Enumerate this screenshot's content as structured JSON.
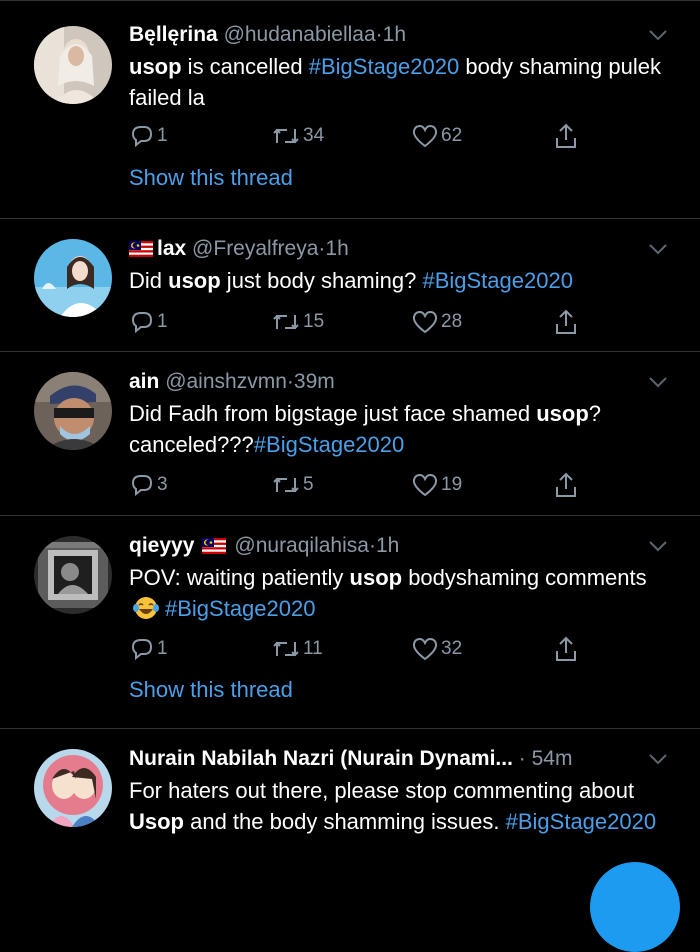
{
  "tweets": [
    {
      "name": "Bęllęrina",
      "handle": "@hudanabiellaa",
      "dot": "·",
      "time": "1h",
      "body": [
        {
          "t": "usop",
          "kw": true
        },
        {
          "t": " is cancelled "
        },
        {
          "t": "#BigStage2020",
          "tag": true
        },
        {
          "t": " body shaming pulek failed la"
        }
      ],
      "replies": "1",
      "retweets": "34",
      "likes": "62",
      "show_thread": "Show this thread"
    },
    {
      "name": "lax",
      "handle": "@Freyalfreya",
      "dot": "·",
      "time": "1h",
      "body": [
        {
          "t": "Did "
        },
        {
          "t": "usop",
          "kw": true
        },
        {
          "t": " just body shaming? "
        },
        {
          "t": "#BigStage2020",
          "tag": true
        }
      ],
      "replies": "1",
      "retweets": "15",
      "likes": "28"
    },
    {
      "name": "ain",
      "handle": "@ainshzvmn",
      "dot": "·",
      "time": "39m",
      "body": [
        {
          "t": "Did Fadh from bigstage just face shamed "
        },
        {
          "t": "usop",
          "kw": true
        },
        {
          "t": "? canceled???"
        },
        {
          "t": "#BigStage2020",
          "tag": true
        }
      ],
      "replies": "3",
      "retweets": "5",
      "likes": "19"
    },
    {
      "name": "qieyyy",
      "handle": "@nuraqilahisa",
      "dot": "·",
      "time": "1h",
      "body": [
        {
          "t": "POV: waiting patiently "
        },
        {
          "t": "usop",
          "kw": true
        },
        {
          "t": " bodyshaming comments"
        }
      ],
      "body_tag": "#BigStage2020",
      "replies": "1",
      "retweets": "11",
      "likes": "32",
      "show_thread": "Show this thread"
    },
    {
      "name": "Nurain Nabilah Nazri (Nurain Dynami...",
      "handle": "",
      "dot": "·",
      "time": "54m",
      "body": [
        {
          "t": "For haters out there, please stop commenting about "
        },
        {
          "t": "Usop",
          "kw": true
        },
        {
          "t": " and the body shamming issues. "
        },
        {
          "t": "#BigStage2020",
          "tag": true
        }
      ]
    }
  ],
  "colors": {
    "background": "#000000",
    "link": "#4a9fe8",
    "muted": "#8b98a5",
    "fab": "#1d9bf0"
  },
  "icons": [
    "reply-icon",
    "retweet-icon",
    "like-icon",
    "share-icon",
    "chevron-down-icon"
  ]
}
